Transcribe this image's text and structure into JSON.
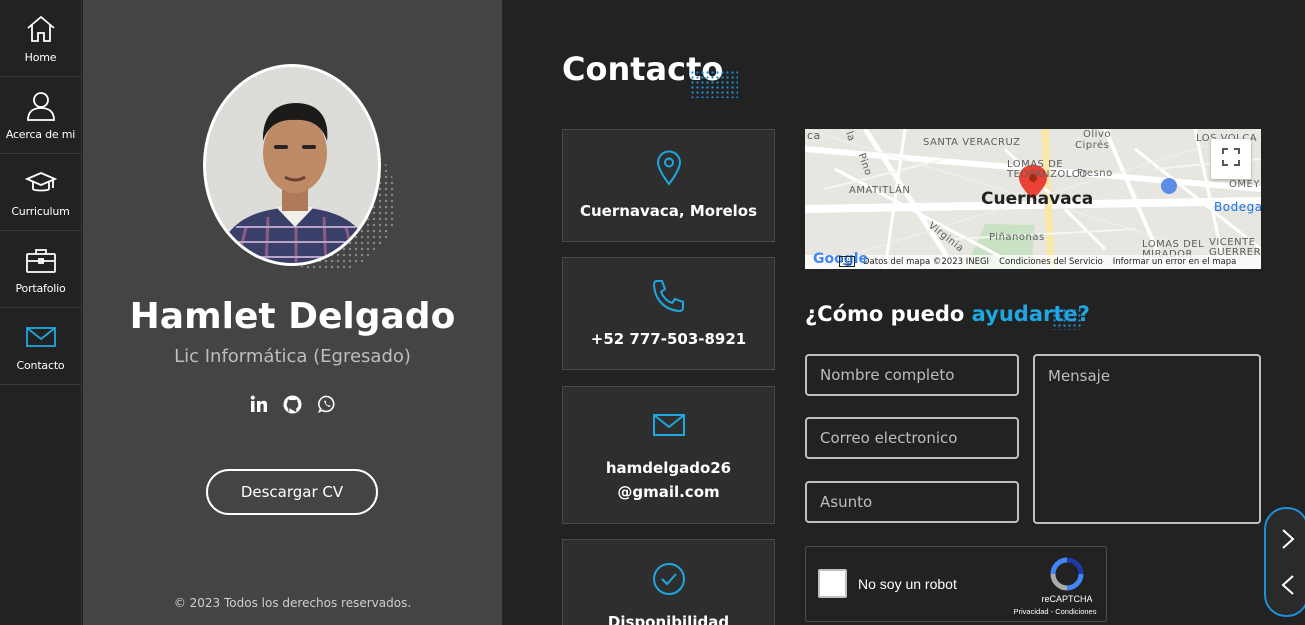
{
  "nav": {
    "items": [
      {
        "label": "Home",
        "icon": "home-icon"
      },
      {
        "label": "Acerca de mi",
        "icon": "user-icon"
      },
      {
        "label": "Curriculum",
        "icon": "graduation-cap-icon"
      },
      {
        "label": "Portafolio",
        "icon": "briefcase-icon"
      },
      {
        "label": "Contacto",
        "icon": "mail-icon"
      }
    ],
    "active": "Contacto"
  },
  "profile": {
    "name": "Hamlet Delgado",
    "role": "Lic Informática (Egresado)",
    "socials": [
      "linkedin-icon",
      "github-icon",
      "whatsapp-icon"
    ],
    "cv_button": "Descargar CV",
    "copyright": "© 2023 Todos los derechos reservados."
  },
  "contact": {
    "title": "Contacto",
    "cards": [
      {
        "icon": "location-pin-icon",
        "text": "Cuernavaca, Morelos"
      },
      {
        "icon": "phone-icon",
        "text": "+52 777-503-8921"
      },
      {
        "icon": "mail-icon",
        "text_line1": "hamdelgado26",
        "text_line2": "@gmail.com"
      },
      {
        "icon": "check-circle-icon",
        "text": "Disponibilidad"
      }
    ]
  },
  "map": {
    "city": "Cuernavaca",
    "labels": [
      "SANTA VERACRUZ",
      "LOMAS DE",
      "TEOPANZOLCO",
      "AMATITLÁN",
      "Olivo",
      "Ciprés",
      "Fresno",
      "LOS VOLCA",
      "OMEY",
      "Bodega",
      "Piñanonas",
      "Virginia",
      "LOMAS DEL",
      "MIRADOR",
      "VICENTE",
      "GUERRERO",
      "Pino",
      "ca",
      "la"
    ],
    "footer": [
      "Datos del mapa ©2023 INEGI",
      "Condiciones del Servicio",
      "Informar un error en el mapa"
    ],
    "google": "Google"
  },
  "form": {
    "title_prefix": "¿Cómo puedo ",
    "title_accent": "ayudarte?",
    "name_placeholder": "Nombre completo",
    "email_placeholder": "Correo electronico",
    "subject_placeholder": "Asunto",
    "message_placeholder": "Mensaje",
    "captcha_label": "No soy un robot",
    "captcha_brand": "reCAPTCHA",
    "captcha_links": "Privacidad - Condiciones"
  },
  "colors": {
    "accent": "#1ea7e1",
    "panel": "#444444",
    "background": "#222222",
    "card": "#2e2e2e"
  }
}
